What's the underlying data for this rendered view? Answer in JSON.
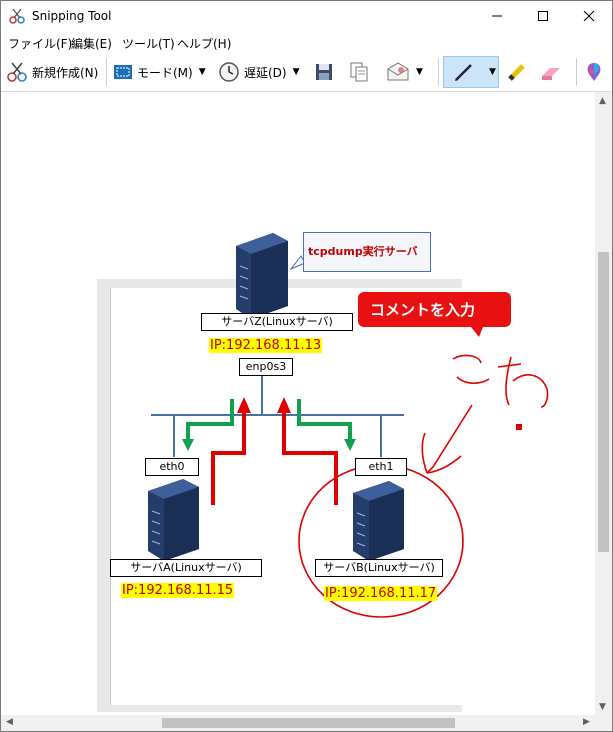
{
  "window": {
    "title": "Snipping Tool"
  },
  "menu": [
    "ファイル(F)",
    "編集(E)",
    "ツール(T)",
    "ヘルプ(H)"
  ],
  "toolbar": {
    "new_label": "新規作成(N)",
    "mode_label": "モード(M)",
    "delay_label": "遅延(D)"
  },
  "diagram": {
    "callout": "tcpdump実行サーバ",
    "comment": "コメントを入力",
    "server_z_label": "サーバZ(Linuxサーバ)",
    "server_z_ip": "IP:192.168.11.13",
    "interface_z": "enp0s3",
    "eth0_label": "eth0",
    "eth1_label": "eth1",
    "server_a_label": "サーバA(Linuxサーバ)",
    "server_a_ip": "IP:192.168.11.15",
    "server_b_label": "サーバB(Linuxサーバ)",
    "server_b_ip": "IP:192.168.11.17"
  },
  "colors": {
    "ip_highlight": "#ffff00",
    "ip_text": "#c00000",
    "arrow_red": "#e00000",
    "arrow_green": "#10a050",
    "pen_ink": "#e00000",
    "network_line": "#4a6fa5"
  }
}
